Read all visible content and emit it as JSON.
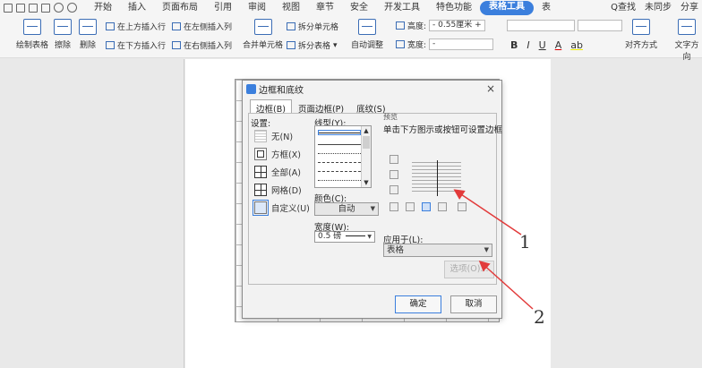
{
  "menubar": {
    "items": [
      "开始",
      "插入",
      "页面布局",
      "引用",
      "审阅",
      "视图",
      "章节",
      "安全",
      "开发工具",
      "特色功能",
      "表格工具",
      "表"
    ],
    "active_index": 10,
    "search": "Q查找",
    "sync": "未同步",
    "share": "分享"
  },
  "ribbon": {
    "draw_table": "绘制表格",
    "erase": "擦除",
    "delete": "删除",
    "insert_above": "在上方插入行",
    "insert_below": "在下方插入行",
    "insert_left": "在左侧插入列",
    "insert_right": "在右侧插入列",
    "merge": "合并单元格",
    "split_cell": "拆分单元格",
    "split_table": "拆分表格",
    "auto_fit": "自动调整",
    "height_label": "高度:",
    "height_value": "0.55厘米",
    "width_label": "宽度:",
    "bold": "B",
    "italic": "I",
    "underline": "U",
    "font_color": "A",
    "highlight": "ab",
    "align": "对齐方式",
    "text_dir": "文字方向"
  },
  "dialog": {
    "title": "边框和底纹",
    "close": "×",
    "tabs": [
      "边框(B)",
      "页面边框(P)",
      "底纹(S)"
    ],
    "settings_label": "设置:",
    "settings": [
      "无(N)",
      "方框(X)",
      "全部(A)",
      "网格(D)",
      "自定义(U)"
    ],
    "selected_setting": 4,
    "line_style_label": "线型(Y):",
    "color_label": "颜色(C):",
    "color_value": "自动",
    "width_label": "宽度(W):",
    "width_value": "0.5  磅",
    "preview_label": "预览",
    "preview_hint": "单击下方图示或按钮可设置边框",
    "apply_to_label": "应用于(L):",
    "apply_to_value": "表格",
    "options_button": "选项(O)...",
    "ok_button": "确定",
    "cancel_button": "取消"
  },
  "annotations": [
    "1",
    "2"
  ]
}
